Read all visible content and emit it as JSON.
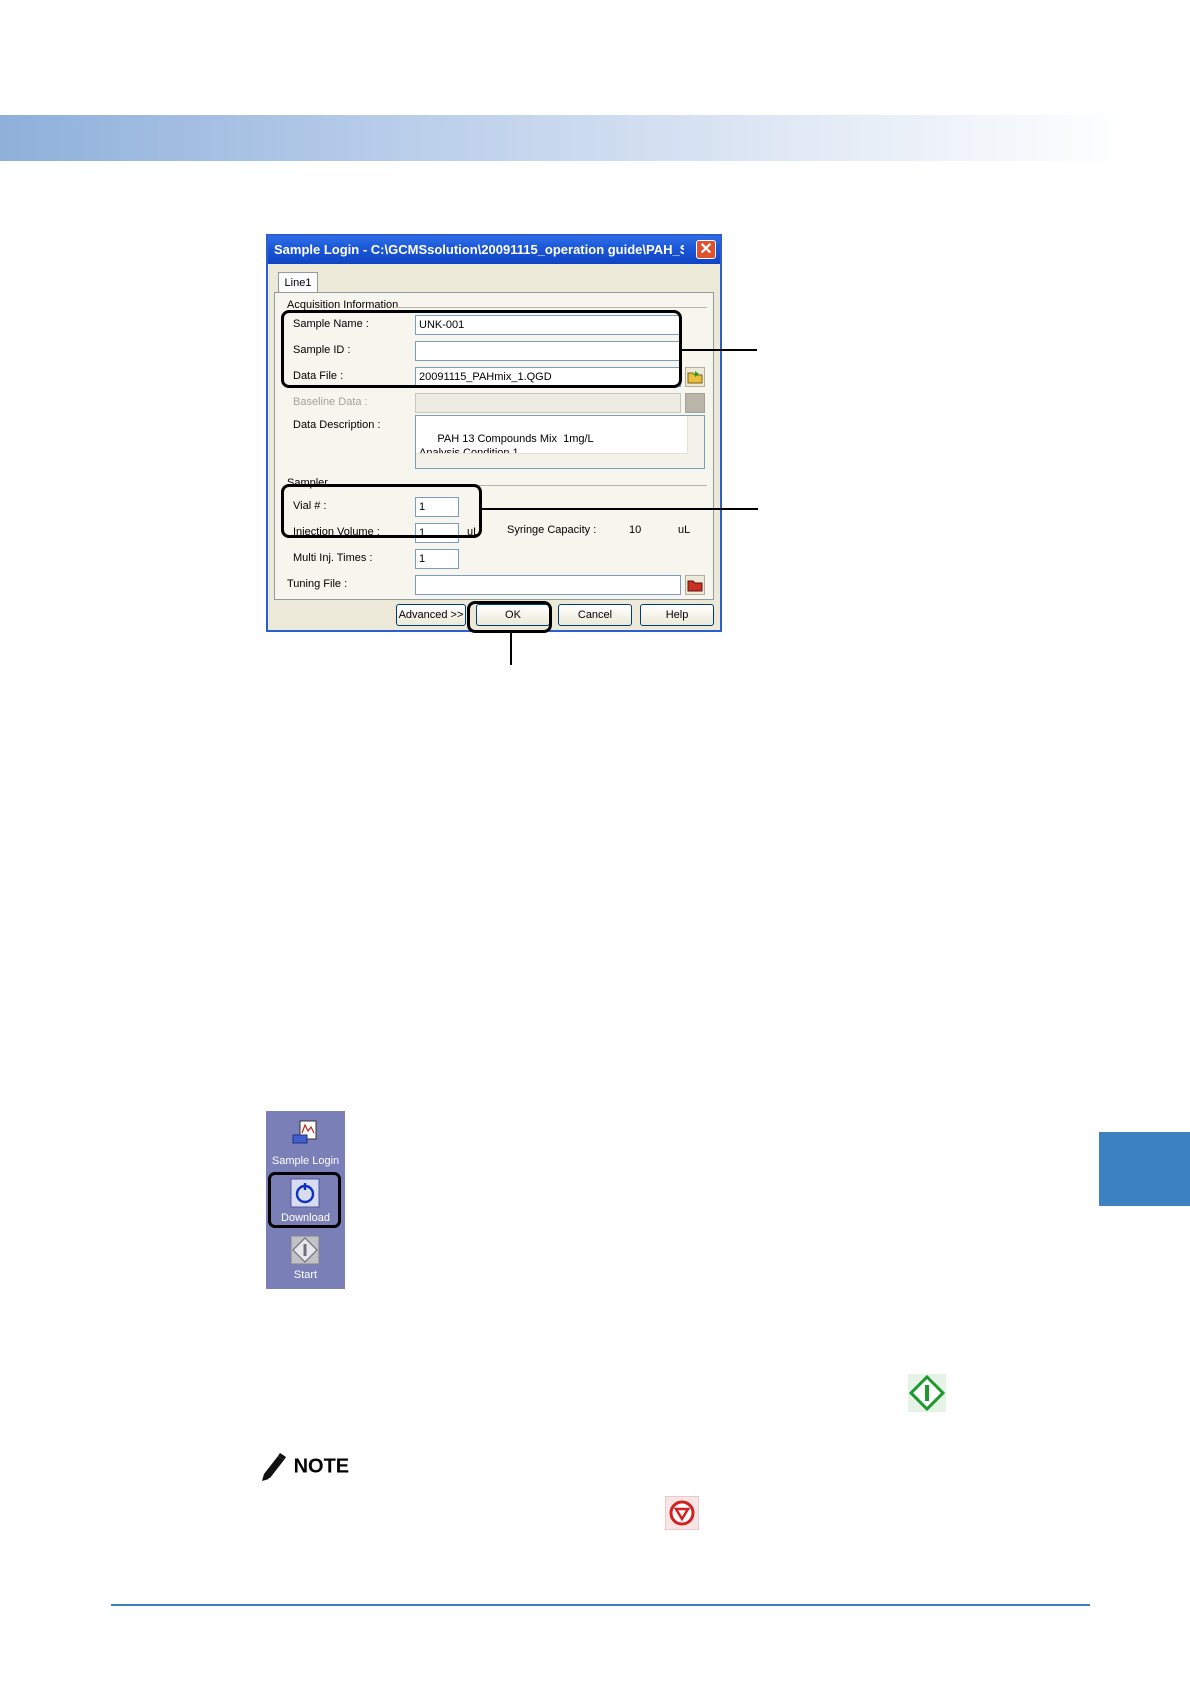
{
  "dialog": {
    "title": "Sample Login - C:\\GCMSsolution\\20091115_operation guide\\PAH_Sc...",
    "tab_label": "Line1",
    "acquisition_group": "Acquisition Information",
    "sample_name_label": "Sample Name :",
    "sample_name_value": "UNK-001",
    "sample_id_label": "Sample ID :",
    "sample_id_value": "",
    "data_file_label": "Data File :",
    "data_file_value": "20091115_PAHmix_1.QGD",
    "baseline_label": "Baseline Data :",
    "baseline_value": "",
    "description_label": "Data Description :",
    "description_value": "PAH 13 Compounds Mix  1mg/L\nAnalysis Condition 1",
    "sampler_group": "Sampler",
    "vial_label": "Vial # :",
    "vial_value": "1",
    "injection_label": "Injection Volume :",
    "injection_value": "1",
    "injection_unit": "uL",
    "syringe_label": "Syringe Capacity :",
    "syringe_value": "10",
    "syringe_unit": "uL",
    "multi_label": "Multi Inj. Times :",
    "multi_value": "1",
    "tuning_label": "Tuning File :",
    "tuning_value": "",
    "advanced_button": "Advanced >>",
    "ok_button": "OK",
    "cancel_button": "Cancel",
    "help_button": "Help"
  },
  "toolbar": {
    "sample_login": "Sample Login",
    "download": "Download",
    "start": "Start"
  },
  "note": {
    "label": "NOTE"
  },
  "colors": {
    "header_band": "#8fb0da",
    "side_tab": "#3d82c0",
    "toolbar_bg": "#7a7fb8",
    "start_icon": "#1a9a2a",
    "stop_icon": "#d42020"
  }
}
